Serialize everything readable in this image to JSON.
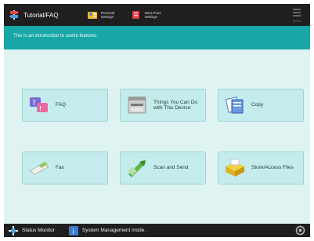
{
  "header": {
    "app_title": "Tutorial/FAQ",
    "shortcuts": [
      {
        "label": "Personal Settings",
        "icon": "personal-settings-icon"
      },
      {
        "label": "Dest./Fwd. Settings",
        "icon": "dest-fwd-settings-icon"
      }
    ],
    "menu_label": "Menu"
  },
  "message": "This is an introduction to useful features.",
  "tiles": [
    {
      "label": "FAQ",
      "icon": "faq-icon"
    },
    {
      "label": "Things You Can Do with This Device",
      "icon": "device-icon"
    },
    {
      "label": "Copy",
      "icon": "copy-icon"
    },
    {
      "label": "Fax",
      "icon": "fax-icon"
    },
    {
      "label": "Scan and Send",
      "icon": "scan-send-icon"
    },
    {
      "label": "Store/Access Files",
      "icon": "store-access-files-icon"
    }
  ],
  "footer": {
    "status_monitor": "Status Monitor",
    "system_message": "System Management mode."
  },
  "colors": {
    "accent": "#17a7a7",
    "bar": "#1f1f1f",
    "main_bg": "#dff3f3",
    "tile_bg": "#c5ecec"
  }
}
